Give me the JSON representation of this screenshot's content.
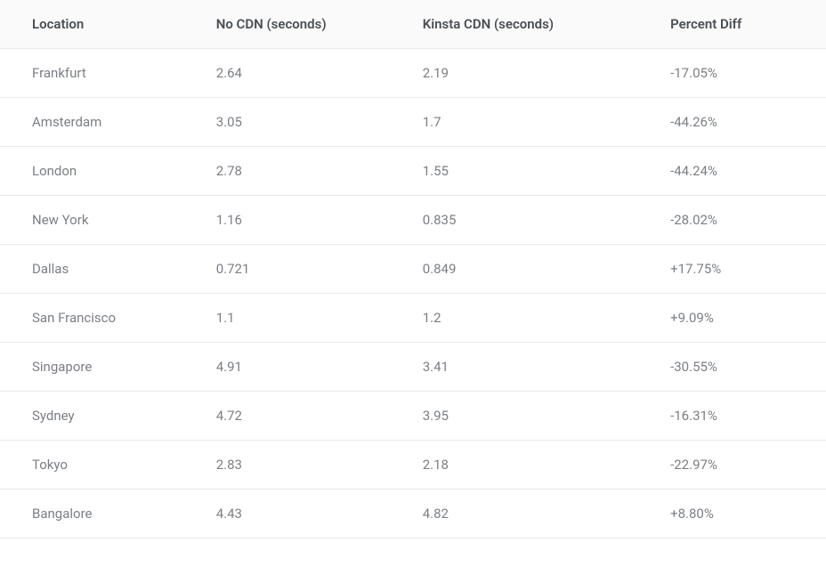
{
  "table": {
    "headers": {
      "location": "Location",
      "no_cdn": "No CDN (seconds)",
      "kinsta_cdn": "Kinsta CDN (seconds)",
      "percent_diff": "Percent Diff"
    },
    "rows": [
      {
        "location": "Frankfurt",
        "no_cdn": "2.64",
        "kinsta_cdn": "2.19",
        "percent_diff": "-17.05%"
      },
      {
        "location": "Amsterdam",
        "no_cdn": "3.05",
        "kinsta_cdn": "1.7",
        "percent_diff": "-44.26%"
      },
      {
        "location": "London",
        "no_cdn": "2.78",
        "kinsta_cdn": "1.55",
        "percent_diff": "-44.24%"
      },
      {
        "location": "New York",
        "no_cdn": "1.16",
        "kinsta_cdn": "0.835",
        "percent_diff": "-28.02%"
      },
      {
        "location": "Dallas",
        "no_cdn": "0.721",
        "kinsta_cdn": "0.849",
        "percent_diff": "+17.75%"
      },
      {
        "location": "San Francisco",
        "no_cdn": "1.1",
        "kinsta_cdn": "1.2",
        "percent_diff": "+9.09%"
      },
      {
        "location": "Singapore",
        "no_cdn": "4.91",
        "kinsta_cdn": "3.41",
        "percent_diff": "-30.55%"
      },
      {
        "location": "Sydney",
        "no_cdn": "4.72",
        "kinsta_cdn": "3.95",
        "percent_diff": "-16.31%"
      },
      {
        "location": "Tokyo",
        "no_cdn": "2.83",
        "kinsta_cdn": "2.18",
        "percent_diff": "-22.97%"
      },
      {
        "location": "Bangalore",
        "no_cdn": "4.43",
        "kinsta_cdn": "4.82",
        "percent_diff": "+8.80%"
      }
    ]
  }
}
